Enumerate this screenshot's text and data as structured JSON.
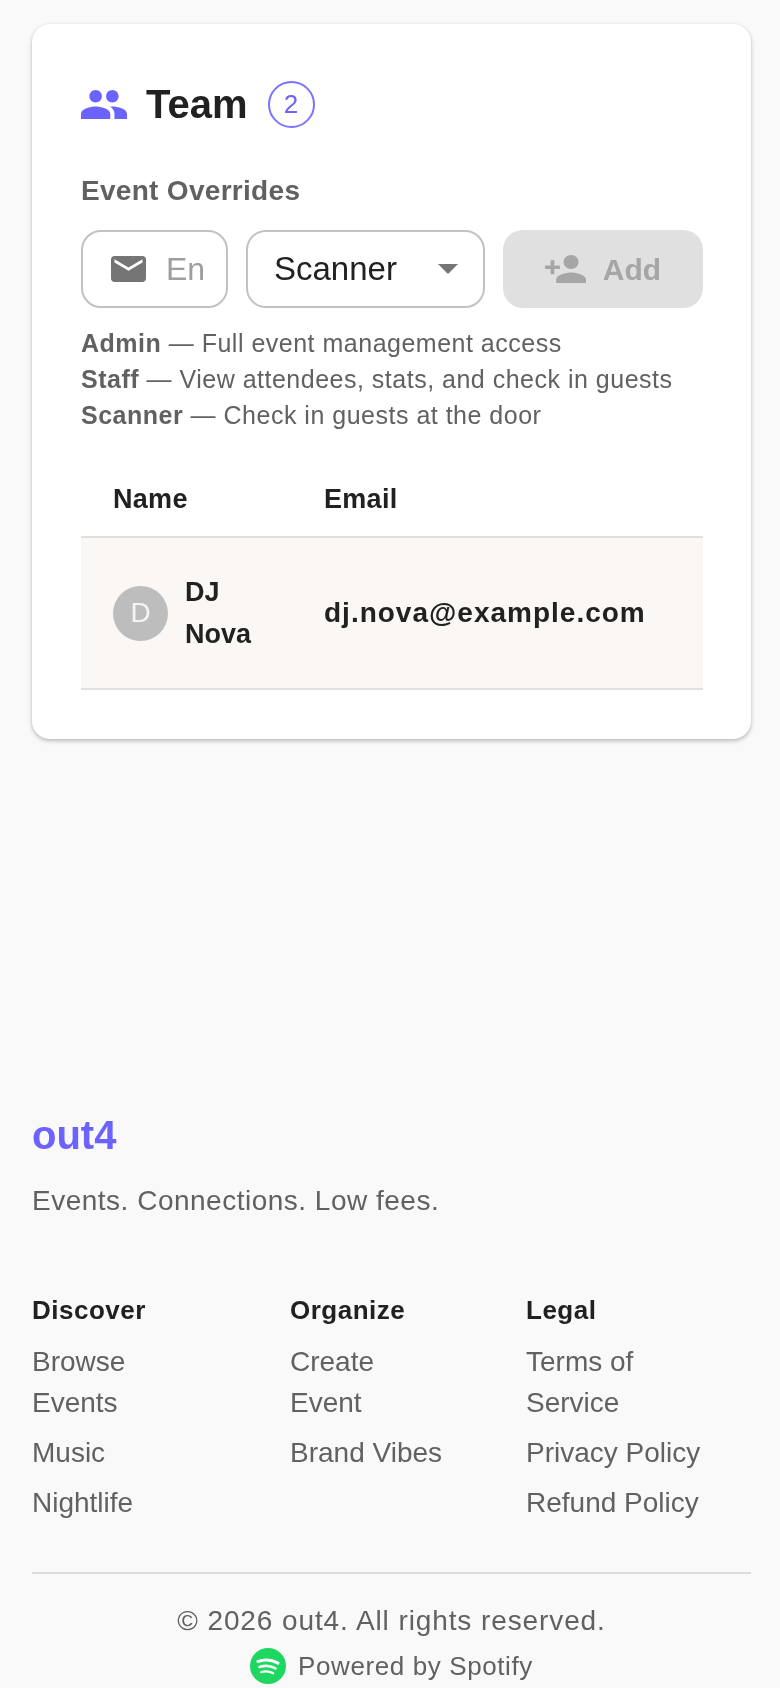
{
  "team_panel": {
    "title": "Team",
    "member_count": "2",
    "section_label": "Event Overrides",
    "email_field": {
      "placeholder": "En"
    },
    "role_select": {
      "value": "Scanner"
    },
    "add_button": {
      "label": "Add",
      "disabled": true
    },
    "role_descriptions": [
      "**Admin** — Full event management access",
      "**Staff** — View attendees, stats, and check in guests",
      "**Scanner** — Check in guests at the door"
    ],
    "table": {
      "columns": [
        "Name",
        "Email"
      ],
      "rows": [
        {
          "initial": "D",
          "name": "DJ Nova",
          "email": "dj.nova@example.com"
        }
      ]
    }
  },
  "footer": {
    "brand": "out4",
    "tagline": "Events. Connections. Low fees.",
    "columns": [
      {
        "heading": "Discover",
        "links": [
          "Browse Events",
          "Music",
          "Nightlife"
        ]
      },
      {
        "heading": "Organize",
        "links": [
          "Create Event",
          "Brand Vibes"
        ]
      },
      {
        "heading": "Legal",
        "links": [
          "Terms of Service",
          "Privacy Policy",
          "Refund Policy"
        ]
      }
    ],
    "copyright": "© 2026 out4. All rights reserved.",
    "powered_by": "Powered by Spotify"
  }
}
